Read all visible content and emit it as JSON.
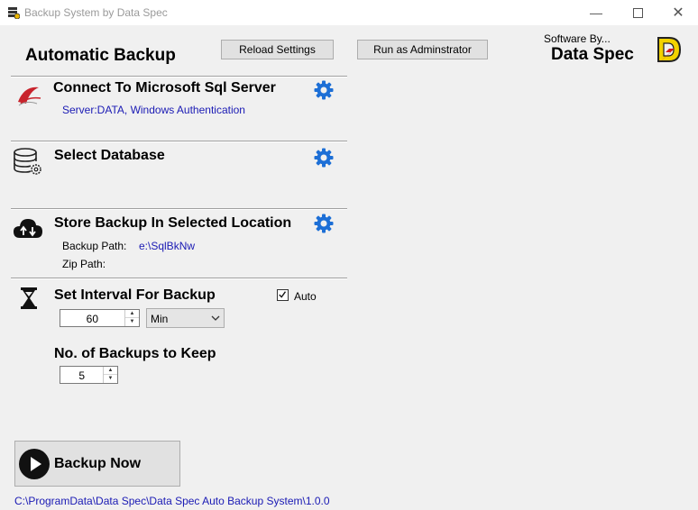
{
  "window": {
    "title": "Backup System by Data Spec"
  },
  "header": {
    "title": "Automatic Backup",
    "reload_label": "Reload Settings",
    "run_admin_label": "Run as Adminstrator",
    "brand_caption": "Software By...",
    "brand_name": "Data Spec"
  },
  "sections": {
    "sql": {
      "title": "Connect To Microsoft Sql Server",
      "server_info": "Server:DATA, Windows Authentication"
    },
    "database": {
      "title": "Select Database"
    },
    "location": {
      "title": "Store Backup In Selected Location",
      "backup_path_label": "Backup Path:",
      "backup_path_value": "e:\\SqlBkNw",
      "zip_path_label": "Zip Path:"
    },
    "interval": {
      "title": "Set Interval For Backup",
      "value": "60",
      "unit": "Min",
      "auto_label": "Auto",
      "auto_checked": true
    },
    "keep": {
      "title": "No. of Backups to Keep",
      "value": "5"
    }
  },
  "actions": {
    "backup_now_label": "Backup Now"
  },
  "footer": {
    "path": "C:\\ProgramData\\Data Spec\\Data Spec Auto Backup System\\1.0.0"
  }
}
